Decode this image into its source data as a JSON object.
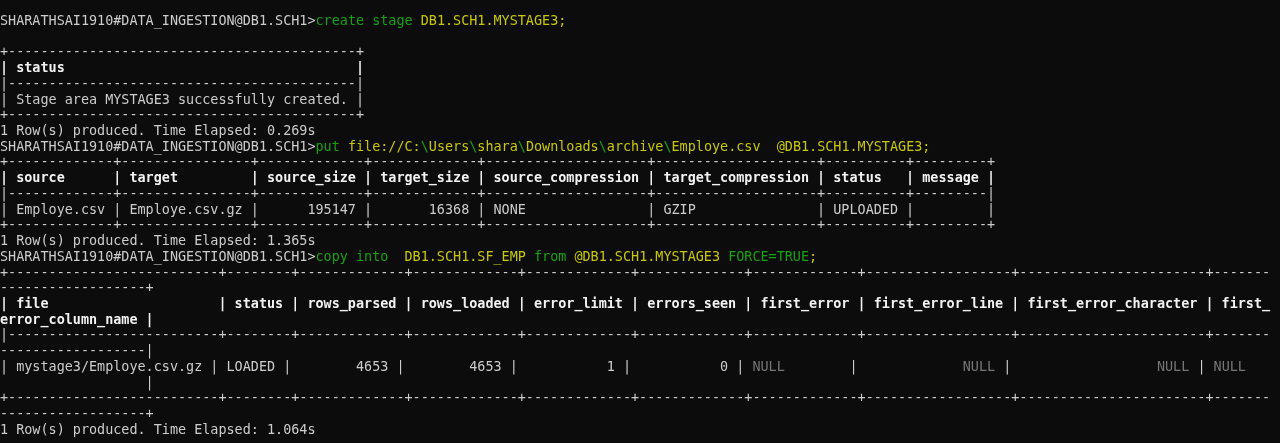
{
  "terminal": {
    "lines": [
      {
        "kind": "prompt",
        "segments": [
          {
            "text": "SHARATHSAI1910#DATA_INGESTION@DB1.SCH1>",
            "kind": "prompt"
          },
          {
            "text": "create stage",
            "kind": "keyword"
          },
          {
            "text": " DB1.SCH1.MYSTAGE3;",
            "kind": "argument"
          }
        ]
      },
      {
        "kind": "blank"
      },
      {
        "kind": "output",
        "segments": [
          {
            "text": "+-------------------------------------------+",
            "kind": "border"
          }
        ]
      },
      {
        "kind": "output",
        "segments": [
          {
            "text": "| status                                    |",
            "kind": "header"
          }
        ]
      },
      {
        "kind": "output",
        "segments": [
          {
            "text": "|-------------------------------------------|",
            "kind": "border"
          }
        ]
      },
      {
        "kind": "output",
        "segments": [
          {
            "text": "| Stage area MYSTAGE3 successfully created. |",
            "kind": "cell"
          }
        ]
      },
      {
        "kind": "output",
        "segments": [
          {
            "text": "+-------------------------------------------+",
            "kind": "border"
          }
        ]
      },
      {
        "kind": "output",
        "segments": [
          {
            "text": "1 Row(s) produced. Time Elapsed: 0.269s",
            "kind": "info"
          }
        ]
      },
      {
        "kind": "prompt",
        "segments": [
          {
            "text": "SHARATHSAI1910#DATA_INGESTION@DB1.SCH1>",
            "kind": "prompt"
          },
          {
            "text": "put",
            "kind": "keyword"
          },
          {
            "text": " file://C:",
            "kind": "argument"
          },
          {
            "text": "\\",
            "kind": "keyword"
          },
          {
            "text": "Users",
            "kind": "argument"
          },
          {
            "text": "\\",
            "kind": "keyword"
          },
          {
            "text": "shara",
            "kind": "argument"
          },
          {
            "text": "\\",
            "kind": "keyword"
          },
          {
            "text": "Downloads",
            "kind": "argument"
          },
          {
            "text": "\\",
            "kind": "keyword"
          },
          {
            "text": "archive",
            "kind": "argument"
          },
          {
            "text": "\\",
            "kind": "keyword"
          },
          {
            "text": "Employe.csv  @DB1.SCH1.MYSTAGE3;",
            "kind": "argument"
          }
        ]
      },
      {
        "kind": "output",
        "segments": [
          {
            "text": "+-------------+----------------+-------------+-------------+--------------------+--------------------+----------+---------+",
            "kind": "border"
          }
        ]
      },
      {
        "kind": "output",
        "segments": [
          {
            "text": "| source      | target         | source_size | target_size | source_compression | target_compression | status   | message |",
            "kind": "header"
          }
        ]
      },
      {
        "kind": "output",
        "segments": [
          {
            "text": "|-------------+----------------+-------------+-------------+--------------------+--------------------+----------+---------|",
            "kind": "border"
          }
        ]
      },
      {
        "kind": "output",
        "segments": [
          {
            "text": "| Employe.csv | Employe.csv.gz |      195147 |       16368 | NONE               | GZIP               | UPLOADED |         |",
            "kind": "cell"
          }
        ]
      },
      {
        "kind": "output",
        "segments": [
          {
            "text": "+-------------+----------------+-------------+-------------+--------------------+--------------------+----------+---------+",
            "kind": "border"
          }
        ]
      },
      {
        "kind": "output",
        "segments": [
          {
            "text": "1 Row(s) produced. Time Elapsed: 1.365s",
            "kind": "info"
          }
        ]
      },
      {
        "kind": "prompt",
        "segments": [
          {
            "text": "SHARATHSAI1910#DATA_INGESTION@DB1.SCH1>",
            "kind": "prompt"
          },
          {
            "text": "copy into",
            "kind": "keyword"
          },
          {
            "text": "  DB1.SCH1.SF_EMP ",
            "kind": "argument"
          },
          {
            "text": "from",
            "kind": "keyword"
          },
          {
            "text": " @DB1.SCH1.MYSTAGE3 ",
            "kind": "argument"
          },
          {
            "text": "FORCE=TRUE",
            "kind": "keyword"
          },
          {
            "text": ";",
            "kind": "argument"
          }
        ]
      },
      {
        "kind": "output",
        "segments": [
          {
            "text": "+--------------------------+--------+-------------+-------------+-------------+-------------+-------------+------------------+-----------------------+-------",
            "kind": "border"
          }
        ]
      },
      {
        "kind": "output",
        "segments": [
          {
            "text": "------------------+",
            "kind": "border"
          }
        ]
      },
      {
        "kind": "output",
        "segments": [
          {
            "text": "| file                     | status | rows_parsed | rows_loaded | error_limit | errors_seen | first_error | first_error_line | first_error_character | first_",
            "kind": "header"
          }
        ]
      },
      {
        "kind": "output",
        "segments": [
          {
            "text": "error_column_name |",
            "kind": "header"
          }
        ]
      },
      {
        "kind": "output",
        "segments": [
          {
            "text": "|--------------------------+--------+-------------+-------------+-------------+-------------+-------------+------------------+-----------------------+-------",
            "kind": "border"
          }
        ]
      },
      {
        "kind": "output",
        "segments": [
          {
            "text": "------------------|",
            "kind": "border"
          }
        ]
      },
      {
        "kind": "output",
        "segments": [
          {
            "text": "| mystage3/Employe.csv.gz | LOADED |        4653 |        4653 |           1 |           0 | ",
            "kind": "cell"
          },
          {
            "text": "NULL",
            "kind": "null"
          },
          {
            "text": "        |             ",
            "kind": "cell"
          },
          {
            "text": "NULL",
            "kind": "null"
          },
          {
            "text": " |                  ",
            "kind": "cell"
          },
          {
            "text": "NULL",
            "kind": "null"
          },
          {
            "text": " | ",
            "kind": "cell"
          },
          {
            "text": "NULL",
            "kind": "null"
          }
        ]
      },
      {
        "kind": "output",
        "segments": [
          {
            "text": "                  |",
            "kind": "cell"
          }
        ]
      },
      {
        "kind": "output",
        "segments": [
          {
            "text": "+--------------------------+--------+-------------+-------------+-------------+-------------+-------------+------------------+-----------------------+-------",
            "kind": "border"
          }
        ]
      },
      {
        "kind": "output",
        "segments": [
          {
            "text": "------------------+",
            "kind": "border"
          }
        ]
      },
      {
        "kind": "output",
        "segments": [
          {
            "text": "1 Row(s) produced. Time Elapsed: 1.064s",
            "kind": "info"
          }
        ]
      }
    ]
  }
}
